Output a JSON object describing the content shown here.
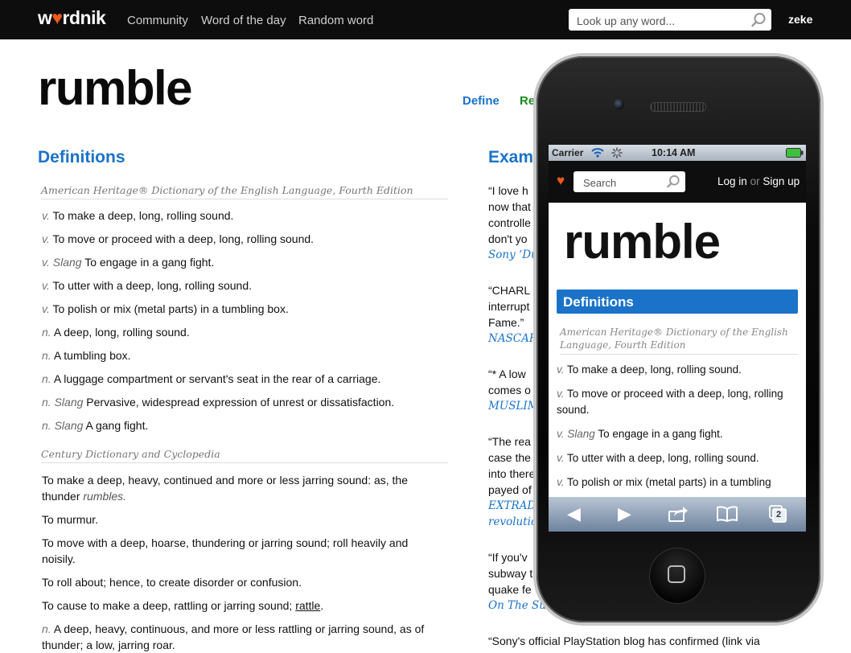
{
  "header": {
    "logo": "wordnik",
    "nav": [
      "Community",
      "Word of the day",
      "Random word"
    ],
    "search_placeholder": "Look up any word...",
    "user": "zeke"
  },
  "word": "rumble",
  "page_links": {
    "define": "Define",
    "second": "Re"
  },
  "definitions": {
    "heading": "Definitions",
    "ahd_source": "American Heritage® Dictionary of the English Language, Fourth Edition",
    "ahd": [
      {
        "pos": "v.",
        "label": "",
        "text": "To make a deep, long, rolling sound."
      },
      {
        "pos": "v.",
        "label": "",
        "text": "To move or proceed with a deep, long, rolling sound."
      },
      {
        "pos": "v.",
        "label": "Slang",
        "text": "To engage in a gang fight."
      },
      {
        "pos": "v.",
        "label": "",
        "text": "To utter with a deep, long, rolling sound."
      },
      {
        "pos": "v.",
        "label": "",
        "text": "To polish or mix (metal parts) in a tumbling box."
      },
      {
        "pos": "n.",
        "label": "",
        "text": "A deep, long, rolling sound."
      },
      {
        "pos": "n.",
        "label": "",
        "text": "A tumbling box."
      },
      {
        "pos": "n.",
        "label": "",
        "text": "A luggage compartment or servant's seat in the rear of a carriage."
      },
      {
        "pos": "n.",
        "label": "Slang",
        "text": "Pervasive, widespread expression of unrest or dissatisfaction."
      },
      {
        "pos": "n.",
        "label": "Slang",
        "text": "A gang fight."
      }
    ],
    "century_source": "Century Dictionary and Cyclopedia",
    "century": {
      "d1_text": "To make a deep, heavy, continued and more or less jarring sound: as, the thunder",
      "d1_italic": "rumbles.",
      "d2": "To murmur.",
      "d3": "To move with a deep, hoarse, thundering or jarring sound; roll heavily and noisily.",
      "d4": "To roll about; hence, to create disorder or confusion.",
      "d5_text": "To cause to make a deep, rattling or jarring sound;",
      "d5_link": "rattle",
      "d5_end": ".",
      "d6_pos": "n.",
      "d6_text": "A deep, heavy, continuous, and more or less rattling or jarring sound, as of",
      "d7": "thunder; a low, jarring roar."
    }
  },
  "examples": {
    "heading": "Exam",
    "e1": [
      "“I love h",
      "now that",
      "controlle",
      "don't yo"
    ],
    "e1_src": "Sony ‘Du",
    "e2": [
      "“CHARL",
      "interrupt",
      "Fame.”"
    ],
    "e2_src": "NASCAR",
    "e3": [
      "“* A low",
      "comes o"
    ],
    "e3_src": "MUSLIM",
    "e4": [
      "“The rea",
      "case the",
      "into there",
      "payed of"
    ],
    "e4_src": [
      "EXTRAD",
      "revolutio"
    ],
    "e5": [
      "“If you'v",
      "subway t",
      "quake fe"
    ],
    "e5_src": "On The Su",
    "e6": "“Sony's official PlayStation blog has confirmed (link via"
  },
  "phone": {
    "carrier": "Carrier",
    "time": "10:14 AM",
    "search_placeholder": "Search",
    "login": "Log in",
    "or": "or",
    "signup": "Sign up",
    "word": "rumble",
    "def_heading": "Definitions",
    "source": "American Heritage® Dictionary of the English Language, Fourth Edition",
    "defs": [
      {
        "pos": "v.",
        "label": "",
        "text": "To make a deep, long, rolling sound."
      },
      {
        "pos": "v.",
        "label": "",
        "text": "To move or proceed with a deep, long, rolling sound."
      },
      {
        "pos": "v.",
        "label": "Slang",
        "text": "To engage in a gang fight."
      },
      {
        "pos": "v.",
        "label": "",
        "text": "To utter with a deep, long, rolling sound."
      },
      {
        "pos": "v.",
        "label": "",
        "text": "To polish or mix (metal parts) in a tumbling"
      }
    ],
    "tabs_count": "2"
  },
  "colors": {
    "link": "#1a73c9",
    "accent": "#ef5a1b",
    "header": "#0d0d0d"
  }
}
